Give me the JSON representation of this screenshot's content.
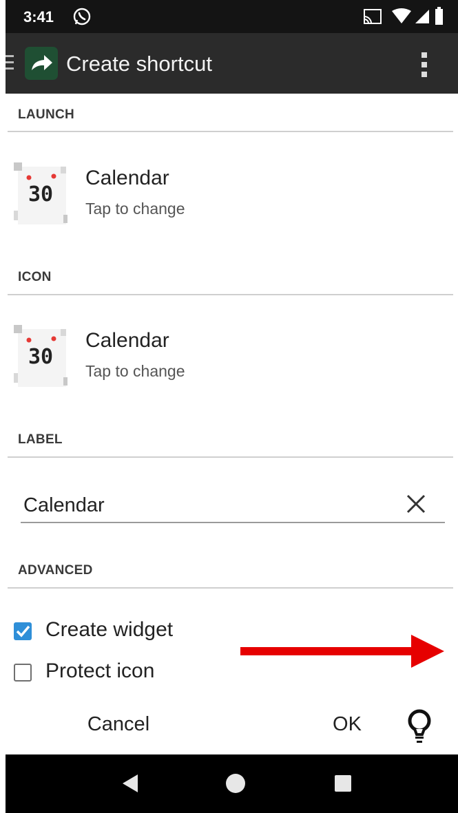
{
  "status_bar": {
    "time": "3:41",
    "icons": [
      "whatsapp-icon",
      "cast-icon",
      "wifi-icon",
      "signal-icon",
      "battery-icon"
    ]
  },
  "app_bar": {
    "title": "Create shortcut",
    "icons": [
      "menu-icon",
      "app-logo-arrow-icon",
      "overflow-menu-icon"
    ],
    "logo_color": "#1f4f33"
  },
  "sections": {
    "launch": {
      "header": "LAUNCH",
      "title": "Calendar",
      "subtitle": "Tap to change",
      "icon_text": "30"
    },
    "icon": {
      "header": "ICON",
      "title": "Calendar",
      "subtitle": "Tap to change",
      "icon_text": "30"
    },
    "label": {
      "header": "LABEL",
      "value": "Calendar"
    },
    "advanced": {
      "header": "ADVANCED",
      "create_widget": {
        "label": "Create widget",
        "checked": true
      },
      "protect_icon": {
        "label": "Protect icon",
        "checked": false
      }
    }
  },
  "buttons": {
    "cancel": "Cancel",
    "ok": "OK"
  },
  "colors": {
    "accent": "#2f8fd8",
    "annotation_arrow": "#e60000"
  }
}
